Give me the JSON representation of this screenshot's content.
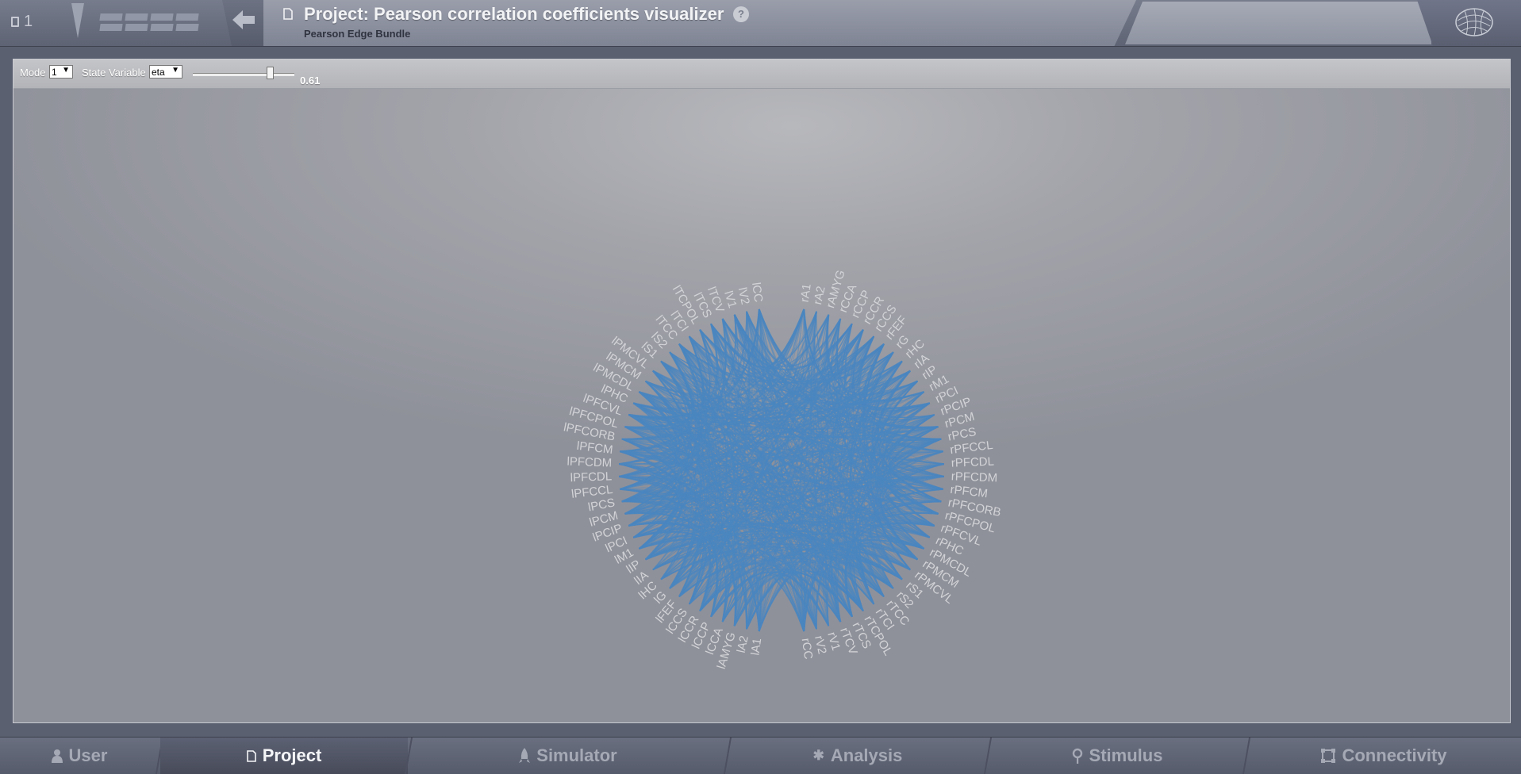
{
  "header": {
    "project_count": "1",
    "title": "Project: Pearson correlation coefficients visualizer",
    "subtitle": "Pearson Edge Bundle",
    "help_label": "?"
  },
  "toolbar": {
    "mode_label": "Mode",
    "mode_value": "1",
    "state_variable_label": "State Variable",
    "state_variable_value": "eta",
    "threshold_value": "0.61",
    "threshold_fraction": 0.76
  },
  "chart_data": {
    "type": "chord",
    "edge_color": "#4a86c0",
    "label_color": "#d2d3d7",
    "regions": [
      "rA1",
      "rA2",
      "rAMYG",
      "rCCA",
      "rCCP",
      "rCCR",
      "rCCS",
      "rFEF",
      "rG",
      "rHC",
      "rIA",
      "rIP",
      "rM1",
      "rPCI",
      "rPCIP",
      "rPCM",
      "rPCS",
      "rPFCCL",
      "rPFCDL",
      "rPFCDM",
      "rPFCM",
      "rPFCORB",
      "rPFCPOL",
      "rPFCVL",
      "rPHC",
      "rPMCDL",
      "rPMCM",
      "rPMCVL",
      "rS1",
      "rS2",
      "rTCC",
      "rTCI",
      "rTCPOL",
      "rTCS",
      "rTCV",
      "rV1",
      "rV2",
      "rCC",
      "lA1",
      "lA2",
      "lAMYG",
      "lCCA",
      "lCCP",
      "lCCR",
      "lCCS",
      "lFEF",
      "lG",
      "lHC",
      "lIA",
      "lIP",
      "lM1",
      "lPCI",
      "lPCIP",
      "lPCM",
      "lPCS",
      "lPFCCL",
      "lPFCDL",
      "lPFCDM",
      "lPFCM",
      "lPFCORB",
      "lPFCPOL",
      "lPFCVL",
      "lPHC",
      "lPMCDL",
      "lPMCM",
      "lPMCVL",
      "lS1",
      "lS2",
      "lTCC",
      "lTCI",
      "lTCPOL",
      "lTCS",
      "lTCV",
      "lV1",
      "lV2",
      "lCC"
    ]
  },
  "bottom_nav": {
    "tabs": [
      {
        "label": "User",
        "icon": "user-icon"
      },
      {
        "label": "Project",
        "icon": "document-icon"
      },
      {
        "label": "Simulator",
        "icon": "rocket-icon"
      },
      {
        "label": "Analysis",
        "icon": "gear-icon"
      },
      {
        "label": "Stimulus",
        "icon": "pin-icon"
      },
      {
        "label": "Connectivity",
        "icon": "network-icon"
      }
    ],
    "active": "Project"
  }
}
